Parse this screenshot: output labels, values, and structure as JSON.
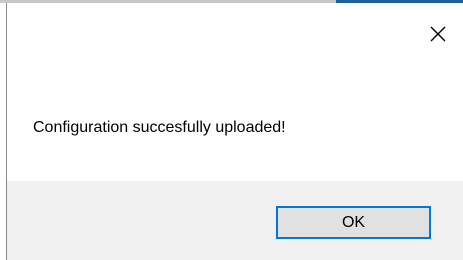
{
  "dialog": {
    "message": "Configuration succesfully uploaded!",
    "ok_label": "OK",
    "close_icon": "close-icon"
  },
  "colors": {
    "accent": "#0078d7",
    "button_face": "#e1e1e1",
    "footer_bg": "#f0f0f0",
    "top_accent": "#1f5f96"
  }
}
